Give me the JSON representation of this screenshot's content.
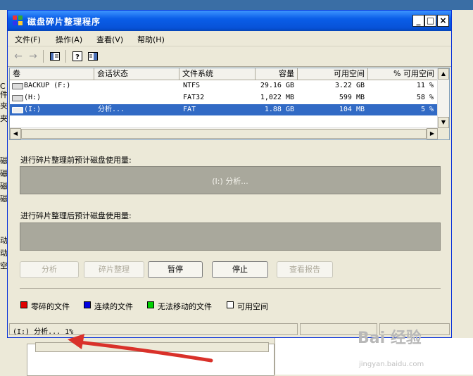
{
  "window": {
    "title": "磁盘碎片整理程序",
    "min_label": "_",
    "max_label": "□",
    "close_label": "×"
  },
  "menu": [
    "文件(F)",
    "操作(A)",
    "查看(V)",
    "帮助(H)"
  ],
  "toolbar_icons": [
    "back-arrow-icon",
    "forward-arrow-icon",
    "show-hide-tree-icon",
    "help-icon",
    "properties-icon"
  ],
  "columns": [
    "卷",
    "会话状态",
    "文件系统",
    "容量",
    "可用空间",
    "% 可用空间"
  ],
  "volumes": [
    {
      "name": "BACKUP (F:)",
      "status": "",
      "fs": "NTFS",
      "capacity": "29.16 GB",
      "free": "3.22 GB",
      "pct": "11 %",
      "selected": false
    },
    {
      "name": "(H:)",
      "status": "",
      "fs": "FAT32",
      "capacity": "1,022 MB",
      "free": "599 MB",
      "pct": "58 %",
      "selected": false
    },
    {
      "name": "(I:)",
      "status": "分析...",
      "fs": "FAT",
      "capacity": "1.88 GB",
      "free": "104 MB",
      "pct": "5 %",
      "selected": true
    }
  ],
  "before_label": "进行碎片整理前预计磁盘使用量:",
  "before_bar_text": "(I:) 分析...",
  "after_label": "进行碎片整理后预计磁盘使用量:",
  "buttons": {
    "analyze": "分析",
    "defrag": "碎片整理",
    "pause": "暂停",
    "stop": "停止",
    "report": "查看报告"
  },
  "legend": [
    {
      "label": "零碎的文件",
      "color": "#e00000"
    },
    {
      "label": "连续的文件",
      "color": "#0000e0"
    },
    {
      "label": "无法移动的文件",
      "color": "#00d000"
    },
    {
      "label": "可用空间",
      "color": "#ffffff"
    }
  ],
  "status": "(I:) 分析... 1%",
  "background": {
    "left_fragments": [
      "C件",
      "夹",
      "夹",
      "磁",
      "磁",
      "磁",
      "磁",
      "动",
      "动",
      "空"
    ]
  },
  "watermark": "Bai 经验",
  "watermark_sub": "jingyan.baidu.com"
}
